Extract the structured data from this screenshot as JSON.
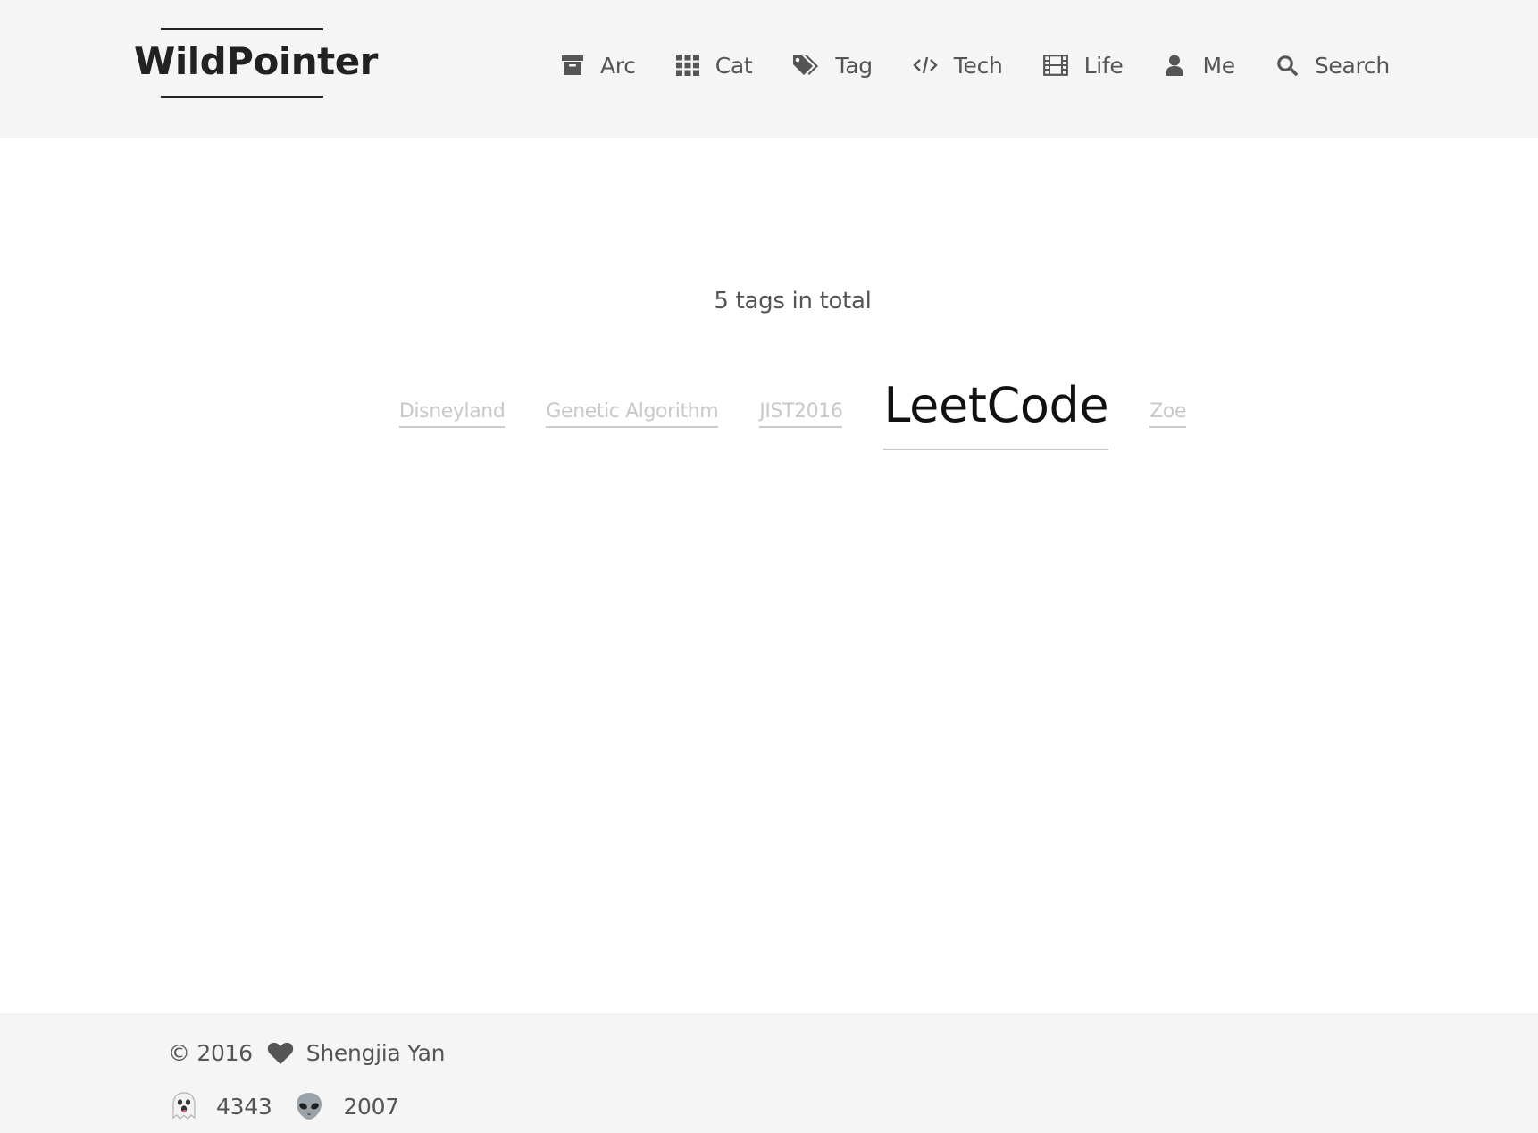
{
  "header": {
    "brand": "WildPointer",
    "nav": [
      {
        "label": "Arc",
        "icon": "archive-icon"
      },
      {
        "label": "Cat",
        "icon": "grid-icon"
      },
      {
        "label": "Tag",
        "icon": "tags-icon"
      },
      {
        "label": "Tech",
        "icon": "code-icon"
      },
      {
        "label": "Life",
        "icon": "film-icon"
      },
      {
        "label": "Me",
        "icon": "user-icon"
      },
      {
        "label": "Search",
        "icon": "search-icon"
      }
    ]
  },
  "main": {
    "total_text": "5 tags in total",
    "tags": [
      {
        "label": "Disneyland"
      },
      {
        "label": "Genetic Algorithm"
      },
      {
        "label": "JIST2016"
      },
      {
        "label": "LeetCode"
      },
      {
        "label": "Zoe"
      }
    ]
  },
  "footer": {
    "copyright": "© 2016",
    "author": "Shengjia Yan",
    "visitors_icon": "ghost-emoji",
    "visitors": "4343",
    "views_icon": "alien-emoji",
    "views": "2007"
  },
  "colors": {
    "header_bg": "#f5f5f5",
    "text": "#555555",
    "tag_muted": "#c9c9c9",
    "tag_emphasis": "#111111"
  }
}
